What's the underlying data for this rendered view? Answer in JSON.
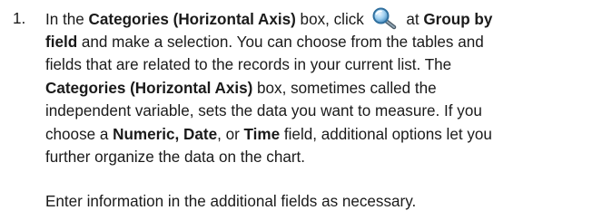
{
  "step": {
    "number": "1.",
    "lines": [
      {
        "a": "In the ",
        "b": "Categories (Horizontal Axis)",
        "c": " box, click ",
        "icon": "magnifier-search-icon",
        "d": " at ",
        "e": "Group by"
      },
      {
        "b": "field",
        "c": " and make a selection. You can choose from the tables and"
      },
      {
        "a": "fields that are related to the records in your current list. The"
      },
      {
        "b": "Categories (Horizontal Axis)",
        "c": " box, sometimes called the"
      },
      {
        "a": "independent variable, sets the data you want to measure. If you"
      },
      {
        "a": "choose a ",
        "b": "Numeric, Date",
        "c": ", or ",
        "d": "Time",
        "e": " field, additional options let you"
      },
      {
        "a": "further organize the data on the chart."
      }
    ]
  },
  "note": "Enter information in the additional fields as necessary."
}
